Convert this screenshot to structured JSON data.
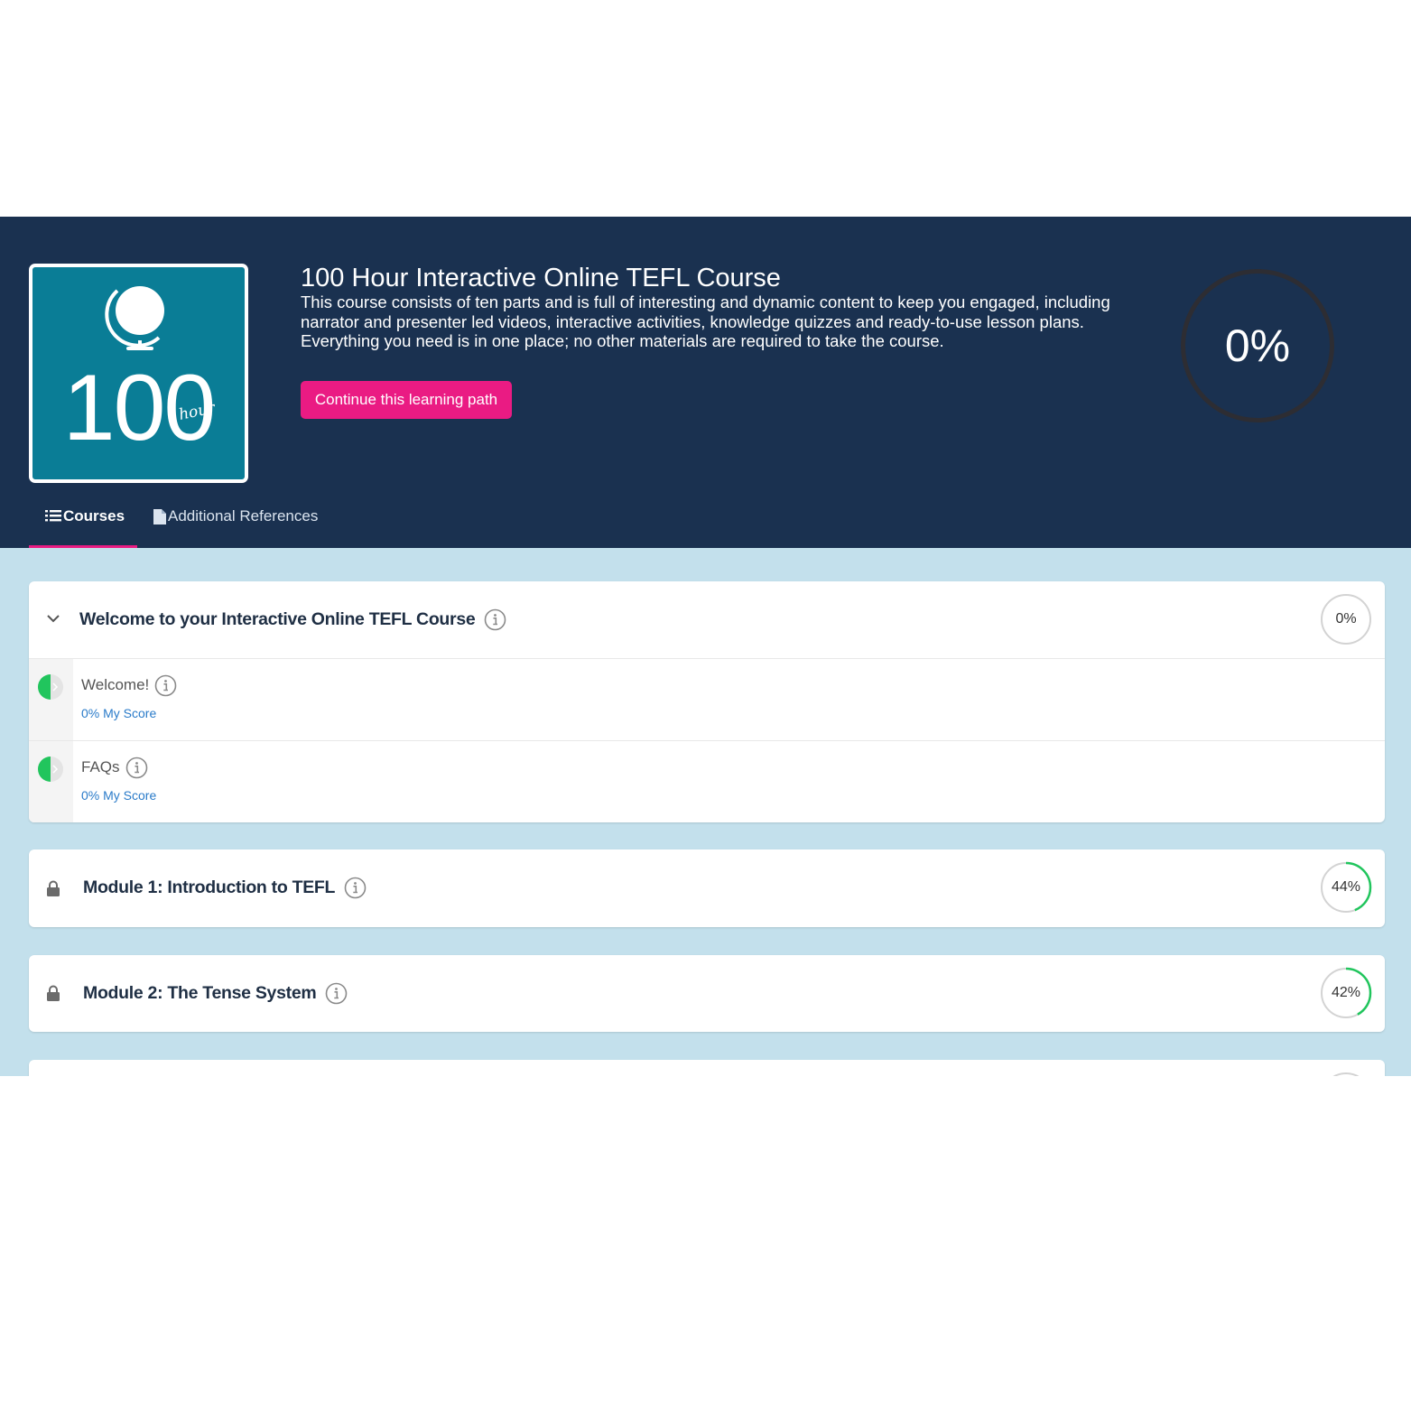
{
  "header": {
    "logo": {
      "number": "100",
      "suffix": "hour"
    },
    "title": "100 Hour Interactive Online TEFL Course",
    "description": "This course consists of ten parts and is full of interesting and dynamic content to keep you engaged, including narrator and presenter led videos, interactive activities, knowledge quizzes and ready-to-use lesson plans. Everything you need is in one place; no other materials are required to take the course.",
    "continue_label": "Continue this learning path",
    "overall_progress": {
      "label": "0%",
      "fraction": 0.0
    }
  },
  "tabs": [
    {
      "label": "Courses",
      "icon": "list-icon",
      "active": true
    },
    {
      "label": "Additional References",
      "icon": "file-icon",
      "active": false
    }
  ],
  "courses": [
    {
      "title": "Welcome to your Interactive Online TEFL Course",
      "expanded": true,
      "locked": false,
      "progress": {
        "label": "0%",
        "fraction": 0.0
      },
      "lessons": [
        {
          "name": "Welcome!",
          "score": "0% My Score"
        },
        {
          "name": "FAQs",
          "score": "0% My Score"
        }
      ]
    },
    {
      "title": "Module 1: Introduction to TEFL",
      "expanded": false,
      "locked": true,
      "progress": {
        "label": "44%",
        "fraction": 0.44
      }
    },
    {
      "title": "Module 2: The Tense System",
      "expanded": false,
      "locked": true,
      "progress": {
        "label": "42%",
        "fraction": 0.42
      }
    }
  ],
  "colors": {
    "header_bg": "#1a3150",
    "accent_pink": "#ea1b83",
    "logo_teal": "#0a7d96",
    "page_bg": "#c3e0ec",
    "progress_green": "#21c55d",
    "link_blue": "#2a7bc9"
  }
}
